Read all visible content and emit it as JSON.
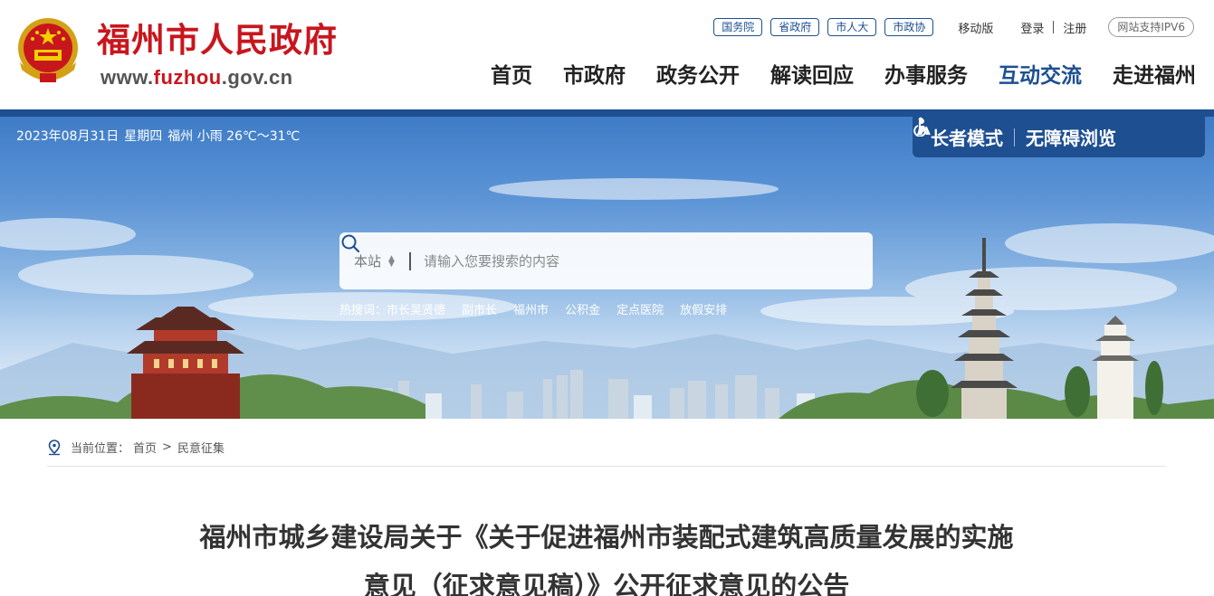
{
  "header": {
    "site_title": "福州市人民政府",
    "site_url_prefix": "www.",
    "site_url_mid": "fuzhou",
    "site_url_suffix": ".gov.cn",
    "top_pills": [
      "国务院",
      "省政府",
      "市人大",
      "市政协"
    ],
    "mobile_label": "移动版",
    "login_label": "登录",
    "register_label": "注册",
    "ipv6_label": "网站支持IPV6",
    "nav": [
      {
        "label": "首页",
        "active": false
      },
      {
        "label": "市政府",
        "active": false
      },
      {
        "label": "政务公开",
        "active": false
      },
      {
        "label": "解读回应",
        "active": false
      },
      {
        "label": "办事服务",
        "active": false
      },
      {
        "label": "互动交流",
        "active": true
      },
      {
        "label": "走进福州",
        "active": false
      }
    ]
  },
  "banner": {
    "date": "2023年08月31日",
    "weekday": "星期四",
    "weather": "福州 小雨 26℃～31℃",
    "elder_mode": "长者模式",
    "accessible": "无障碍浏览",
    "search_scope": "本站",
    "search_placeholder": "请输入您要搜索的内容",
    "hot_label": "热搜词：",
    "hot_words": [
      "市长吴贤德",
      "副市长",
      "福州市",
      "公积金",
      "定点医院",
      "放假安排"
    ]
  },
  "content": {
    "breadcrumb_label": "当前位置：",
    "breadcrumb_home": "首页",
    "breadcrumb_current": "民意征集",
    "title_line1": "福州市城乡建设局关于《关于促进福州市装配式建筑高质量发展的实施",
    "title_line2": "意见（征求意见稿）》公开征求意见的公告"
  },
  "colors": {
    "brand_red": "#c8161d",
    "brand_blue": "#1d4f91"
  }
}
